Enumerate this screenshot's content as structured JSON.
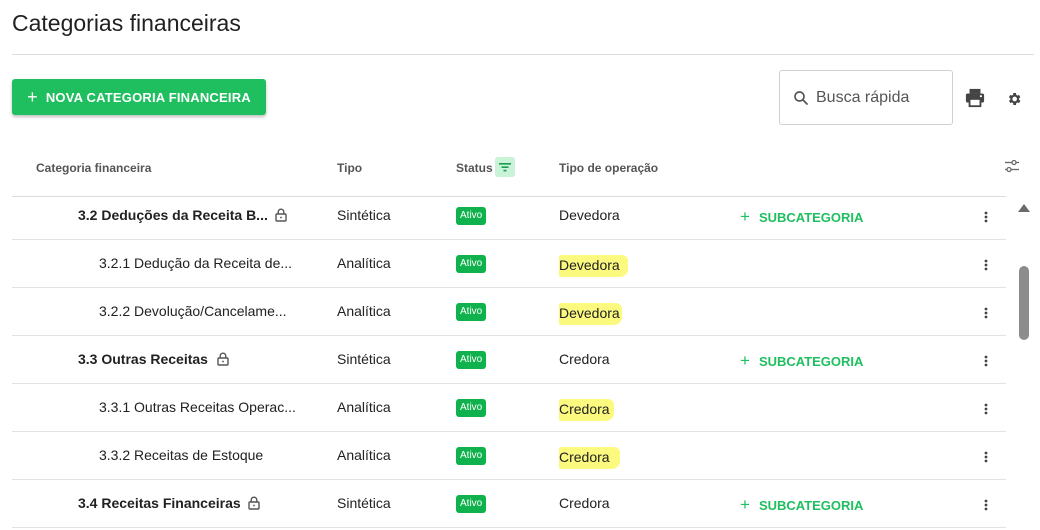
{
  "page": {
    "title": "Categorias financeiras"
  },
  "toolbar": {
    "new_button_icon": "plus-icon",
    "new_button_label": "NOVA CATEGORIA FINANCEIRA",
    "search_placeholder": "Busca rápida",
    "search_value": "",
    "accent_color": "#1fbf5f"
  },
  "table": {
    "columns": [
      "Categoria financeira",
      "Tipo",
      "Status",
      "Tipo de operação"
    ],
    "subcategory_label": "SUBCATEGORIA",
    "rows": [
      {
        "name": "3.2 Deduções da Receita B...",
        "locked": true,
        "level": 2,
        "tipo": "Sintética",
        "status": "Ativo",
        "operacao": "Devedora",
        "highlight": false,
        "subcategory": true
      },
      {
        "name": "3.2.1 Dedução da Receita de...",
        "locked": false,
        "level": 3,
        "tipo": "Analítica",
        "status": "Ativo",
        "operacao": "Devedora",
        "highlight": true,
        "subcategory": false
      },
      {
        "name": "3.2.2 Devolução/Cancelame...",
        "locked": false,
        "level": 3,
        "tipo": "Analítica",
        "status": "Ativo",
        "operacao": "Devedora",
        "highlight": true,
        "subcategory": false
      },
      {
        "name": "3.3 Outras Receitas",
        "locked": true,
        "level": 2,
        "tipo": "Sintética",
        "status": "Ativo",
        "operacao": "Credora",
        "highlight": false,
        "subcategory": true
      },
      {
        "name": "3.3.1 Outras Receitas Operac...",
        "locked": false,
        "level": 3,
        "tipo": "Analítica",
        "status": "Ativo",
        "operacao": "Credora",
        "highlight": true,
        "subcategory": false
      },
      {
        "name": "3.3.2 Receitas de Estoque",
        "locked": false,
        "level": 3,
        "tipo": "Analítica",
        "status": "Ativo",
        "operacao": "Credora",
        "highlight": true,
        "subcategory": false
      },
      {
        "name": "3.4 Receitas Financeiras",
        "locked": true,
        "level": 2,
        "tipo": "Sintética",
        "status": "Ativo",
        "operacao": "Credora",
        "highlight": false,
        "subcategory": true
      }
    ]
  }
}
